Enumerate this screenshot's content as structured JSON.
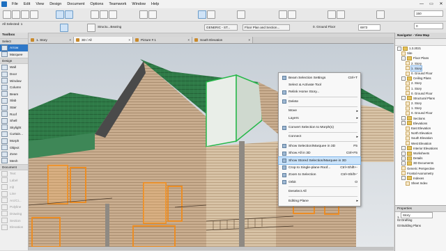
{
  "menubar": {
    "items": [
      "File",
      "Edit",
      "View",
      "Design",
      "Document",
      "Options",
      "Teamwork",
      "Window",
      "Help"
    ],
    "window_buttons": [
      "—",
      "▭",
      "✕"
    ]
  },
  "toolbar": {
    "all_selected_label": "All Selected: 1",
    "structure_dropdown": "Structu...Bearing",
    "generic_dropdown": "GENERIC - ST...",
    "floor_plan_dropdown": "Floor Plan and Section...",
    "home_story_value": "0. Ground Floor",
    "coord_a": "2773",
    "coord_b": "6973",
    "value_top": "150",
    "value_bottom": "0"
  },
  "toolbox": {
    "title": "Toolbox",
    "select_label": "Select",
    "sections": {
      "design": "Design",
      "document": "Document"
    },
    "top_tools": [
      "Arrow",
      "Marquee"
    ],
    "design_tools": [
      "Wall",
      "Door",
      "Window",
      "Column",
      "Beam",
      "Slab",
      "Stair",
      "Roof",
      "Shell",
      "Skylight",
      "Curtain...",
      "Morph",
      "Object",
      "Zone",
      "Mesh"
    ],
    "document_tools": [
      "Text",
      "Label",
      "Fill",
      "Line",
      "Arc/Ci...",
      "Polyline",
      "Drawing",
      "Section",
      "Elevation"
    ]
  },
  "tabs": [
    {
      "label": "1. Story",
      "active": false
    },
    {
      "label": "3D / All",
      "active": true
    },
    {
      "label": "Picture # 1",
      "active": false
    },
    {
      "label": "South Elevation",
      "active": false
    }
  ],
  "context_menu": {
    "items": [
      {
        "label": "Beam Selection Settings",
        "shortcut": "Ctrl+T",
        "icon": "settings-icon",
        "sep_after": false
      },
      {
        "label": "Select & Activate Tool",
        "shortcut": "",
        "icon": "",
        "sep_after": false
      },
      {
        "label": "Relink Home Story...",
        "shortcut": "",
        "icon": "link-icon",
        "sep_after": true
      },
      {
        "label": "Delete",
        "shortcut": "",
        "icon": "delete-icon",
        "sep_after": true
      },
      {
        "label": "Move",
        "shortcut": "",
        "icon": "",
        "submenu": true,
        "sep_after": false
      },
      {
        "label": "Layers",
        "shortcut": "",
        "icon": "",
        "submenu": true,
        "sep_after": true
      },
      {
        "label": "Convert Selection to Morph(s)",
        "shortcut": "",
        "icon": "morph-icon",
        "sep_after": true
      },
      {
        "label": "Connect",
        "shortcut": "",
        "icon": "",
        "submenu": true,
        "sep_after": true
      },
      {
        "label": "Show Selection/Marquee in 3D",
        "shortcut": "F5",
        "icon": "show-3d-icon",
        "sep_after": false
      },
      {
        "label": "Show All in 3D",
        "shortcut": "Ctrl+F5",
        "icon": "show-all-icon",
        "sep_after": false
      },
      {
        "label": "Show Stored Selection/Marquee in 3D",
        "shortcut": "",
        "icon": "stored-icon",
        "highlighted": true,
        "sep_after": false
      },
      {
        "label": "Crop to Single-plane Roof...",
        "shortcut": "Ctrl+Shift+-",
        "icon": "crop-icon",
        "sep_after": false
      },
      {
        "label": "Zoom to Selection",
        "shortcut": "Ctrl+Shift+'",
        "icon": "zoom-icon",
        "sep_after": false
      },
      {
        "label": "Orbit",
        "shortcut": "O",
        "icon": "orbit-icon",
        "sep_after": true
      },
      {
        "label": "Deselect All",
        "shortcut": "",
        "icon": "",
        "sep_after": true
      },
      {
        "label": "Editing Plane",
        "shortcut": "",
        "icon": "",
        "submenu": true,
        "sep_after": false
      }
    ]
  },
  "navigator": {
    "title": "Navigator - View Map",
    "tree": [
      {
        "label": "1.3.2021",
        "depth": 0,
        "kind": "folder"
      },
      {
        "label": "Site",
        "depth": 1,
        "kind": "view"
      },
      {
        "label": "Floor Plans",
        "depth": 1,
        "kind": "folder"
      },
      {
        "label": "2. Story",
        "depth": 2,
        "kind": "view"
      },
      {
        "label": "1. Story",
        "depth": 2,
        "kind": "view",
        "selected": true
      },
      {
        "label": "0. Ground Floor",
        "depth": 2,
        "kind": "view"
      },
      {
        "label": "Ceiling Plans",
        "depth": 1,
        "kind": "folder"
      },
      {
        "label": "2. Story",
        "depth": 2,
        "kind": "view"
      },
      {
        "label": "1. Story",
        "depth": 2,
        "kind": "view"
      },
      {
        "label": "0. Ground Floor",
        "depth": 2,
        "kind": "view"
      },
      {
        "label": "Structural Plans",
        "depth": 1,
        "kind": "folder"
      },
      {
        "label": "2. Story",
        "depth": 2,
        "kind": "view"
      },
      {
        "label": "1. Story",
        "depth": 2,
        "kind": "view"
      },
      {
        "label": "0. Ground Floor",
        "depth": 2,
        "kind": "view"
      },
      {
        "label": "Sections",
        "depth": 1,
        "kind": "folder"
      },
      {
        "label": "Elevations",
        "depth": 1,
        "kind": "folder"
      },
      {
        "label": "East Elevation",
        "depth": 2,
        "kind": "view"
      },
      {
        "label": "North Elevation",
        "depth": 2,
        "kind": "view"
      },
      {
        "label": "South Elevation",
        "depth": 2,
        "kind": "view"
      },
      {
        "label": "West Elevation",
        "depth": 2,
        "kind": "view"
      },
      {
        "label": "Interior Elevations",
        "depth": 1,
        "kind": "folder"
      },
      {
        "label": "Worksheets",
        "depth": 1,
        "kind": "folder"
      },
      {
        "label": "Details",
        "depth": 1,
        "kind": "folder"
      },
      {
        "label": "3D Documents",
        "depth": 1,
        "kind": "folder"
      },
      {
        "label": "Generic Perspective",
        "depth": 1,
        "kind": "view"
      },
      {
        "label": "Frontal Axonometry",
        "depth": 1,
        "kind": "view"
      },
      {
        "label": "Indexes",
        "depth": 1,
        "kind": "folder"
      },
      {
        "label": "Sheet Index",
        "depth": 2,
        "kind": "view"
      }
    ]
  },
  "properties": {
    "title": "Properties",
    "story_number": "1.",
    "story_name": "Story",
    "rows": [
      "02 Drafting",
      "03 Building Plans"
    ]
  }
}
